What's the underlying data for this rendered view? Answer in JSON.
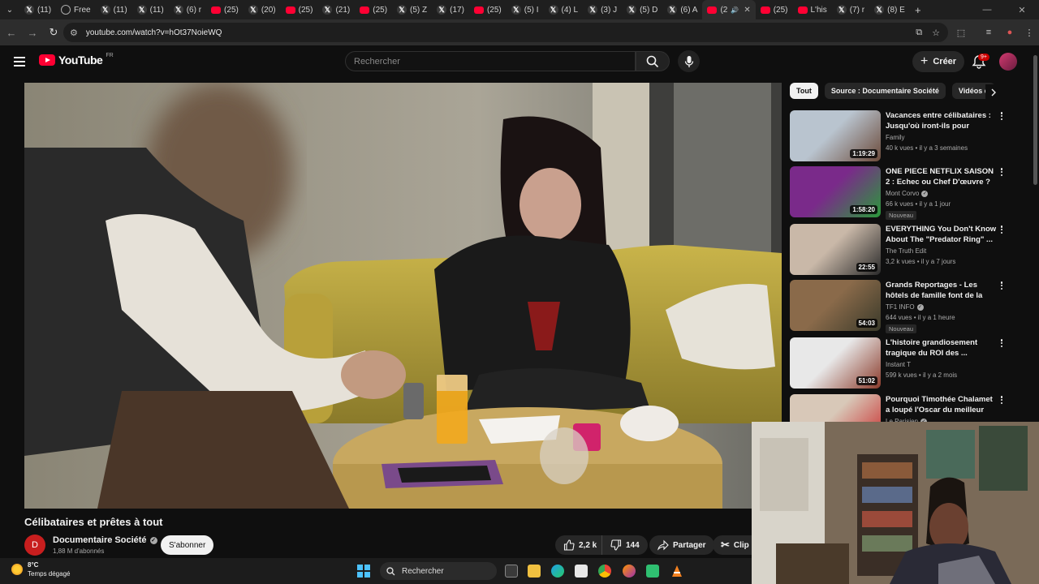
{
  "browser": {
    "tabs": [
      {
        "icon": "x",
        "label": "(11)"
      },
      {
        "icon": "free",
        "label": "Free"
      },
      {
        "icon": "x",
        "label": "(11)"
      },
      {
        "icon": "x",
        "label": "(11)"
      },
      {
        "icon": "x",
        "label": "(6) r"
      },
      {
        "icon": "youtube",
        "label": "(25)"
      },
      {
        "icon": "x",
        "label": "(20)"
      },
      {
        "icon": "youtube",
        "label": "(25)"
      },
      {
        "icon": "x",
        "label": "(21)"
      },
      {
        "icon": "youtube",
        "label": "(25)"
      },
      {
        "icon": "x",
        "label": "(5) Z"
      },
      {
        "icon": "x",
        "label": "(17)"
      },
      {
        "icon": "youtube",
        "label": "(25)"
      },
      {
        "icon": "x",
        "label": "(5) I"
      },
      {
        "icon": "x",
        "label": "(4) L"
      },
      {
        "icon": "x",
        "label": "(3) J"
      },
      {
        "icon": "x",
        "label": "(5) D"
      },
      {
        "icon": "x",
        "label": "(6) A"
      },
      {
        "icon": "youtube",
        "label": "(2"
      },
      {
        "icon": "youtube",
        "label": "(25)"
      },
      {
        "icon": "youtube",
        "label": "L'his"
      },
      {
        "icon": "x",
        "label": "(7) r"
      },
      {
        "icon": "x",
        "label": "(8) E"
      }
    ],
    "active_tab_index": 18,
    "url": "youtube.com/watch?v=hOt37NoieWQ"
  },
  "youtube": {
    "logo_text": "YouTube",
    "country_code": "FR",
    "search_placeholder": "Rechercher",
    "create_label": "Créer",
    "notif_count": "9+"
  },
  "video": {
    "title": "Célibataires et prêtes à tout",
    "channel_initial": "D",
    "channel": "Documentaire Société",
    "subscribers": "1,88 M d'abonnés",
    "subscribe_label": "S'abonner",
    "likes": "2,2 k",
    "dislikes": "144",
    "share_label": "Partager",
    "clip_label": "Clip"
  },
  "chips": [
    "Tout",
    "Source : Documentaire Société",
    "Vidéos d"
  ],
  "recommendations": [
    {
      "title": "Vacances entre célibataires : Jusqu'où iront-ils pour trouver ...",
      "channel": "Family",
      "verified": false,
      "meta": "40 k vues • il y a 3 semaines",
      "duration": "1:19:29",
      "badge": "",
      "thumb_colors": [
        "#b9c4cf",
        "#6b4a3a"
      ]
    },
    {
      "title": "ONE PIECE NETFLIX SAISON 2 : Echec ou Chef D'œuvre ? ...",
      "channel": "Mont Corvo",
      "verified": true,
      "meta": "66 k vues • il y a 1 jour",
      "duration": "1:58:20",
      "badge": "Nouveau",
      "thumb_colors": [
        "#7a2a8a",
        "#2a9a3a"
      ]
    },
    {
      "title": "EVERYTHING You Don't Know About The \"Predator Ring\" ...",
      "channel": "The Truth Edit",
      "verified": false,
      "meta": "3,2 k vues • il y a 7 jours",
      "duration": "22:55",
      "badge": "",
      "thumb_colors": [
        "#c9b8a8",
        "#2a2a2a"
      ]
    },
    {
      "title": "Grands Reportages - Les hôtels de famille font de la résistanc...",
      "channel": "TF1 INFO",
      "verified": true,
      "meta": "644 vues • il y a 1 heure",
      "duration": "54:03",
      "badge": "Nouveau",
      "thumb_colors": [
        "#8a6a4a",
        "#3a3a2a"
      ]
    },
    {
      "title": "L'histoire grandiosement tragique du ROI des ...",
      "channel": "Instant T",
      "verified": false,
      "meta": "599 k vues • il y a 2 mois",
      "duration": "51:02",
      "badge": "",
      "thumb_colors": [
        "#e8e8e8",
        "#8a3a2a"
      ]
    },
    {
      "title": "Pourquoi Timothée Chalamet a loupé l'Oscar du meilleur acteur",
      "channel": "Le Parisien",
      "verified": true,
      "meta": "",
      "duration": "",
      "badge": "",
      "thumb_colors": [
        "#d8c8b8",
        "#c82a2a"
      ]
    }
  ],
  "taskbar": {
    "temperature": "8°C",
    "weather_text": "Temps dégagé",
    "search_label": "Rechercher"
  },
  "colors": {
    "yt_red": "#ff0033",
    "background": "#0f0f0f",
    "chip_bg": "#272727"
  }
}
